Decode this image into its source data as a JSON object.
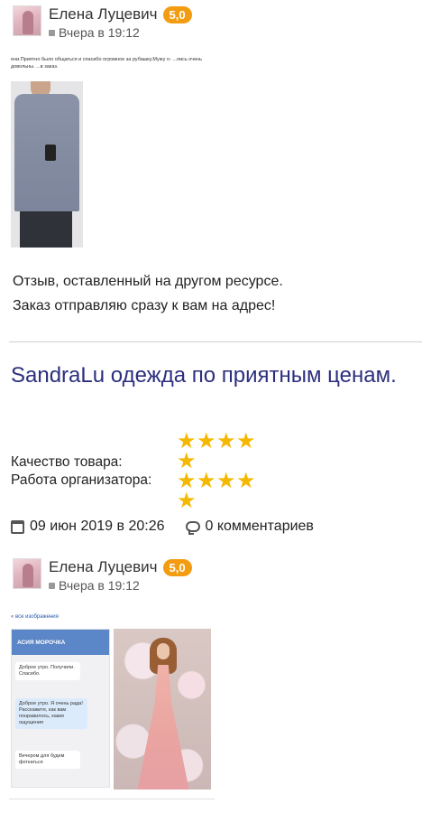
{
  "posts": [
    {
      "author": "Елена Луцевич",
      "rating": "5,0",
      "date": "Вчера в 19:12"
    },
    {
      "author": "Елена Луцевич",
      "rating": "5,0",
      "date": "Вчера в 19:12"
    }
  ],
  "review1": {
    "image_caption": "ени.Приятно было общаться и спасибо огромное за рубашку.Мужу о- ...лись очень довольны. ...в заказ.",
    "text_line1": "Отзыв, оставленный на другом ресурсе.",
    "text_line2": "Заказ отправляю сразу к вам на адрес!"
  },
  "shop": {
    "title": "SandraLu одежда по приятным ценам.",
    "ratings": [
      {
        "label": "Качество товара:",
        "stars": 5
      },
      {
        "label": "Работа организатора:",
        "stars": 5
      }
    ],
    "star_color": "#f5b800",
    "date": "09 июн 2019 в 20:26",
    "comments": "0 комментариев"
  },
  "review2": {
    "image_caption": "« все изображения",
    "chat_title": "АСИЯ МОРОЧКА",
    "bubbles": [
      "Доброе утро. Получили. Спасибо.",
      "Доброе утро. Я очень рада! Расскажите, как вам понравилось, какие ощущения",
      "Вечером для будем фоткаться"
    ]
  },
  "colors": {
    "badge": "#f39c12",
    "title": "#2b2f7d"
  }
}
